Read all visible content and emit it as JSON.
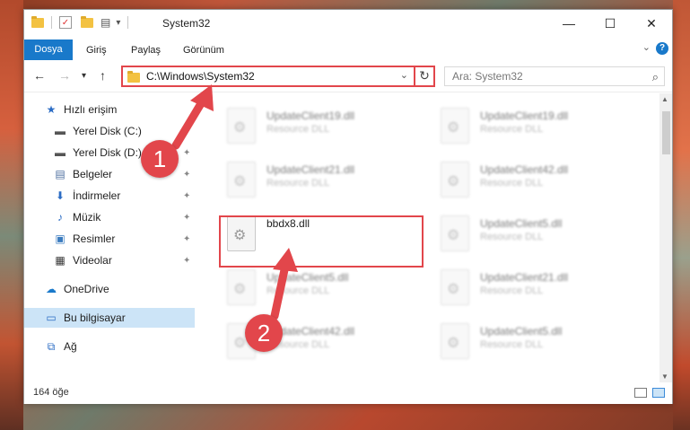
{
  "window": {
    "title": "System32",
    "minimize_glyph": "—",
    "maximize_glyph": "☐",
    "close_glyph": "✕",
    "qa_check_glyph": "✓",
    "qa_down_glyph": "▾",
    "qa_props_glyph": "▤"
  },
  "ribbon": {
    "tabs": [
      "Dosya",
      "Giriş",
      "Paylaş",
      "Görünüm"
    ],
    "help_glyph": "?",
    "expand_glyph": "⌄"
  },
  "nav": {
    "back_glyph": "←",
    "forward_glyph": "→",
    "recent_glyph": "▾",
    "up_glyph": "↑",
    "address": "C:\\Windows\\System32",
    "address_chevron_glyph": "⌄",
    "refresh_glyph": "↻",
    "search_placeholder": "Ara: System32",
    "search_glyph": "⌕"
  },
  "sidebar": {
    "items": [
      {
        "label": "Hızlı erişim",
        "icon": "star-icon",
        "glyph": "★",
        "color": "#2b6cc4",
        "pinned": false
      },
      {
        "label": "Yerel Disk (C:)",
        "icon": "drive-icon",
        "glyph": "▬",
        "color": "#555555",
        "pinned": true
      },
      {
        "label": "Yerel Disk (D:)",
        "icon": "drive-icon",
        "glyph": "▬",
        "color": "#555555",
        "pinned": true
      },
      {
        "label": "Belgeler",
        "icon": "documents-icon",
        "glyph": "▤",
        "color": "#4c6e9e",
        "pinned": true
      },
      {
        "label": "İndirmeler",
        "icon": "download-icon",
        "glyph": "⬇",
        "color": "#2b6cc4",
        "pinned": true
      },
      {
        "label": "Müzik",
        "icon": "music-icon",
        "glyph": "♪",
        "color": "#2b6cc4",
        "pinned": true
      },
      {
        "label": "Resimler",
        "icon": "pictures-icon",
        "glyph": "▣",
        "color": "#3a7bbf",
        "pinned": true
      },
      {
        "label": "Videolar",
        "icon": "videos-icon",
        "glyph": "▦",
        "color": "#333333",
        "pinned": true
      },
      {
        "label": "OneDrive",
        "icon": "onedrive-icon",
        "glyph": "☁",
        "color": "#1979ca",
        "pinned": false
      },
      {
        "label": "Bu bilgisayar",
        "icon": "computer-icon",
        "glyph": "▭",
        "color": "#2b6cc4",
        "pinned": false,
        "selected": true
      },
      {
        "label": "Ağ",
        "icon": "network-icon",
        "glyph": "⧉",
        "color": "#2b6cc4",
        "pinned": false
      }
    ],
    "pin_glyph": "📌"
  },
  "files": {
    "left_column": [
      {
        "name": "UpdateClient19.dll",
        "type": "Resource DLL",
        "blurred": true
      },
      {
        "name": "UpdateClient21.dll",
        "type": "Resource DLL",
        "blurred": true
      },
      {
        "name": "bbdx8.dll",
        "type": "",
        "blurred": false
      },
      {
        "name": "UpdateClient5.dll",
        "type": "Resource DLL",
        "blurred": true
      },
      {
        "name": "UpdateClient42.dll",
        "type": "Resource DLL",
        "blurred": true
      }
    ],
    "right_column": [
      {
        "name": "UpdateClient19.dll",
        "type": "Resource DLL",
        "blurred": true
      },
      {
        "name": "UpdateClient42.dll",
        "type": "Resource DLL",
        "blurred": true
      },
      {
        "name": "UpdateClient5.dll",
        "type": "Resource DLL",
        "blurred": true
      },
      {
        "name": "UpdateClient21.dll",
        "type": "Resource DLL",
        "blurred": true
      },
      {
        "name": "UpdateClient5.dll",
        "type": "Resource DLL",
        "blurred": true
      }
    ]
  },
  "status": {
    "item_count": "164 öğe"
  },
  "annotations": {
    "badge_1": "1",
    "badge_2": "2",
    "color": "#e2464b"
  },
  "colors": {
    "accent": "#1979ca",
    "selection": "#cce4f7",
    "highlight": "#e2464b"
  }
}
